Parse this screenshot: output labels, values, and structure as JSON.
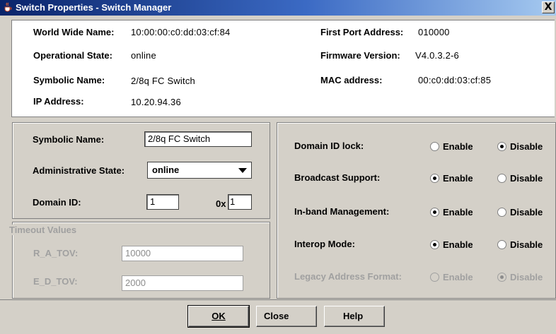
{
  "window": {
    "title": "Switch Properties - Switch Manager",
    "close_glyph": "X"
  },
  "info": {
    "wwn_label": "World Wide Name:",
    "wwn_value": "10:00:00:c0:dd:03:cf:84",
    "opstate_label": "Operational State:",
    "opstate_value": "online",
    "symname_label": "Symbolic Name:",
    "symname_value": "2/8q FC Switch",
    "ip_label": "IP Address:",
    "ip_value": "10.20.94.36",
    "fpa_label": "First Port Address:",
    "fpa_value": "010000",
    "fw_label": "Firmware Version:",
    "fw_value": "V4.0.3.2-6",
    "mac_label": "MAC address:",
    "mac_value": "00:c0:dd:03:cf:85"
  },
  "form": {
    "symname_label": "Symbolic Name:",
    "symname_value": "2/8q FC Switch",
    "adminstate_label": "Administrative State:",
    "adminstate_value": "online",
    "domainid_label": "Domain ID:",
    "domainid_value": "1",
    "hex_prefix": "0x",
    "hex_value": "1"
  },
  "timeouts": {
    "legend": "Timeout Values",
    "ratov_label": "R_A_TOV:",
    "ratov_value": "10000",
    "edtov_label": "E_D_TOV:",
    "edtov_value": "2000"
  },
  "options": [
    {
      "label": "Domain ID lock:",
      "enable": "Enable",
      "disable": "Disable",
      "selected": "disable",
      "enabled": true
    },
    {
      "label": "Broadcast Support:",
      "enable": "Enable",
      "disable": "Disable",
      "selected": "enable",
      "enabled": true
    },
    {
      "label": "In-band Management:",
      "enable": "Enable",
      "disable": "Disable",
      "selected": "enable",
      "enabled": true
    },
    {
      "label": "Interop Mode:",
      "enable": "Enable",
      "disable": "Disable",
      "selected": "enable",
      "enabled": true
    },
    {
      "label": "Legacy Address Format:",
      "enable": "Enable",
      "disable": "Disable",
      "selected": "disable",
      "enabled": false
    }
  ],
  "buttons": {
    "ok": "OK",
    "close": "Close",
    "help": "Help"
  },
  "icons": {
    "window": "java-cup-icon",
    "close": "close-icon"
  }
}
